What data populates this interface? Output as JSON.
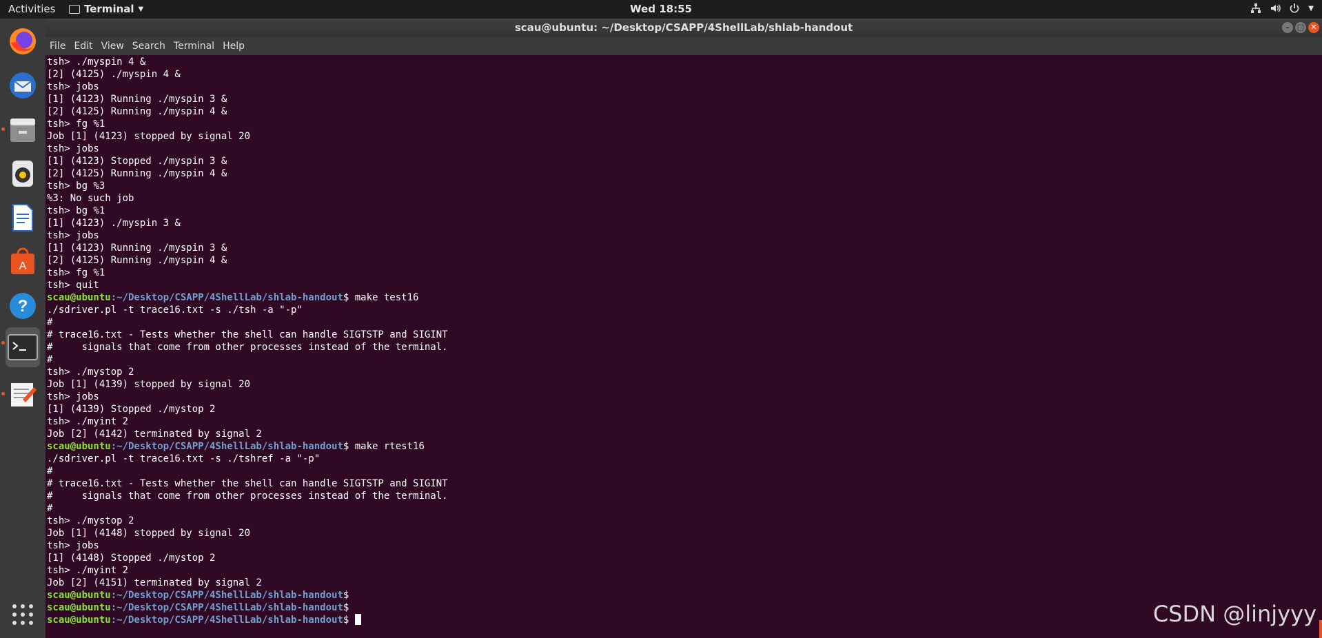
{
  "topbar": {
    "activities": "Activities",
    "app_name": "Terminal",
    "clock": "Wed 18:55"
  },
  "dock": {
    "items": [
      {
        "name": "firefox-icon"
      },
      {
        "name": "thunderbird-icon"
      },
      {
        "name": "files-icon"
      },
      {
        "name": "rhythmbox-icon"
      },
      {
        "name": "libreoffice-writer-icon"
      },
      {
        "name": "software-center-icon"
      },
      {
        "name": "help-icon"
      },
      {
        "name": "terminal-icon"
      },
      {
        "name": "text-editor-icon"
      }
    ]
  },
  "window": {
    "title": "scau@ubuntu: ~/Desktop/CSAPP/4ShellLab/shlab-handout",
    "menu": [
      "File",
      "Edit",
      "View",
      "Search",
      "Terminal",
      "Help"
    ]
  },
  "terminal": {
    "prompt_user": "scau@ubuntu",
    "prompt_path": ":~/Desktop/CSAPP/4ShellLab/shlab-handout",
    "lines": [
      {
        "text": "tsh> ./myspin 4 &"
      },
      {
        "text": "[2] (4125) ./myspin 4 &"
      },
      {
        "text": "tsh> jobs"
      },
      {
        "text": "[1] (4123) Running ./myspin 3 &"
      },
      {
        "text": "[2] (4125) Running ./myspin 4 &"
      },
      {
        "text": "tsh> fg %1"
      },
      {
        "text": "Job [1] (4123) stopped by signal 20"
      },
      {
        "text": "tsh> jobs"
      },
      {
        "text": "[1] (4123) Stopped ./myspin 3 &"
      },
      {
        "text": "[2] (4125) Running ./myspin 4 &"
      },
      {
        "text": "tsh> bg %3"
      },
      {
        "text": "%3: No such job"
      },
      {
        "text": "tsh> bg %1"
      },
      {
        "text": "[1] (4123) ./myspin 3 &"
      },
      {
        "text": "tsh> jobs"
      },
      {
        "text": "[1] (4123) Running ./myspin 3 &"
      },
      {
        "text": "[2] (4125) Running ./myspin 4 &"
      },
      {
        "text": "tsh> fg %1"
      },
      {
        "text": "tsh> quit"
      },
      {
        "prompt": true,
        "cmd": "$ make test16"
      },
      {
        "text": "./sdriver.pl -t trace16.txt -s ./tsh -a \"-p\""
      },
      {
        "text": "#"
      },
      {
        "text": "# trace16.txt - Tests whether the shell can handle SIGTSTP and SIGINT"
      },
      {
        "text": "#     signals that come from other processes instead of the terminal."
      },
      {
        "text": "#"
      },
      {
        "text": "tsh> ./mystop 2"
      },
      {
        "text": "Job [1] (4139) stopped by signal 20"
      },
      {
        "text": "tsh> jobs"
      },
      {
        "text": "[1] (4139) Stopped ./mystop 2"
      },
      {
        "text": "tsh> ./myint 2"
      },
      {
        "text": "Job [2] (4142) terminated by signal 2"
      },
      {
        "prompt": true,
        "cmd": "$ make rtest16"
      },
      {
        "text": "./sdriver.pl -t trace16.txt -s ./tshref -a \"-p\""
      },
      {
        "text": "#"
      },
      {
        "text": "# trace16.txt - Tests whether the shell can handle SIGTSTP and SIGINT"
      },
      {
        "text": "#     signals that come from other processes instead of the terminal."
      },
      {
        "text": "#"
      },
      {
        "text": "tsh> ./mystop 2"
      },
      {
        "text": "Job [1] (4148) stopped by signal 20"
      },
      {
        "text": "tsh> jobs"
      },
      {
        "text": "[1] (4148) Stopped ./mystop 2"
      },
      {
        "text": "tsh> ./myint 2"
      },
      {
        "text": "Job [2] (4151) terminated by signal 2"
      },
      {
        "prompt": true,
        "cmd": "$"
      },
      {
        "prompt": true,
        "cmd": "$"
      },
      {
        "prompt": true,
        "cmd": "$ ",
        "cursor": true
      }
    ]
  },
  "watermark": "CSDN @linjyyy",
  "colors": {
    "terminal_bg": "#300a24",
    "prompt_user": "#8ae234",
    "prompt_path": "#729fcf",
    "accent": "#e95420"
  }
}
